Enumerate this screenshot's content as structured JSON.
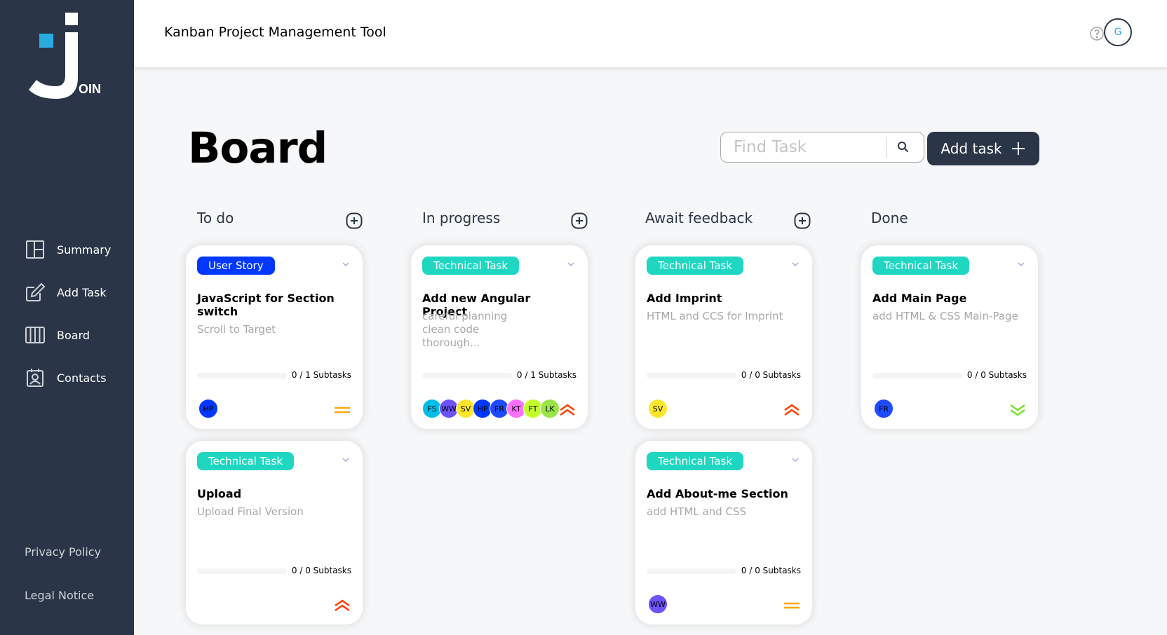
{
  "app": {
    "logo_text": "OIN",
    "header_title": "Kanban Project Management Tool",
    "user_initial": "G"
  },
  "sidebar": {
    "items": [
      {
        "label": "Summary",
        "icon": "summary-icon"
      },
      {
        "label": "Add Task",
        "icon": "edit-icon"
      },
      {
        "label": "Board",
        "icon": "board-icon"
      },
      {
        "label": "Contacts",
        "icon": "contacts-icon"
      }
    ],
    "footer": {
      "privacy": "Privacy Policy",
      "legal": "Legal Notice"
    }
  },
  "board": {
    "title": "Board",
    "search_placeholder": "Find Task",
    "add_task_label": "Add task"
  },
  "colors": {
    "sidebar": "#2a3647",
    "user_story": "#0038ff",
    "technical_task": "#1fd7c1",
    "prio_urgent": "#ff3d00",
    "prio_medium": "#ffa800",
    "prio_low": "#7ae229"
  },
  "columns": [
    {
      "title": "To do",
      "cards": [
        {
          "category": "User Story",
          "title": "JavaScript for Section switch",
          "description": "Scroll to Target",
          "subtasks": "0 / 1 Subtasks",
          "assignees": [
            {
              "initials": "HP",
              "color": "#0038ff"
            }
          ],
          "priority": "medium"
        },
        {
          "category": "Technical Task",
          "title": "Upload",
          "description": "Upload Final Version",
          "subtasks": "0 / 0 Subtasks",
          "assignees": [],
          "priority": "urgent"
        }
      ]
    },
    {
      "title": "In progress",
      "cards": [
        {
          "category": "Technical Task",
          "title": "Add new Angular Project",
          "description": "careful planning\nclean code\nthorough...",
          "subtasks": "0 / 1 Subtasks",
          "assignees": [
            {
              "initials": "FS",
              "color": "#00bee8"
            },
            {
              "initials": "WW",
              "color": "#6e52ff"
            },
            {
              "initials": "SV",
              "color": "#ffe62b"
            },
            {
              "initials": "HP",
              "color": "#0038ff"
            },
            {
              "initials": "FR",
              "color": "#1f4bff"
            },
            {
              "initials": "KT",
              "color": "#fc71ff"
            },
            {
              "initials": "FT",
              "color": "#c3ff2b"
            },
            {
              "initials": "LK",
              "color": "#9ae64a"
            }
          ],
          "priority": "urgent"
        }
      ]
    },
    {
      "title": "Await feedback",
      "cards": [
        {
          "category": "Technical Task",
          "title": "Add Imprint",
          "description": "HTML and CCS for Imprint",
          "subtasks": "0 / 0 Subtasks",
          "assignees": [
            {
              "initials": "SV",
              "color": "#ffe62b"
            }
          ],
          "priority": "urgent"
        },
        {
          "category": "Technical Task",
          "title": "Add About-me Section",
          "description": "add HTML and CSS",
          "subtasks": "0 / 0 Subtasks",
          "assignees": [
            {
              "initials": "WW",
              "color": "#6e52ff"
            }
          ],
          "priority": "medium"
        }
      ]
    },
    {
      "title": "Done",
      "cards": [
        {
          "category": "Technical Task",
          "title": "Add Main Page",
          "description": "add HTML & CSS Main-Page",
          "subtasks": "0 / 0 Subtasks",
          "assignees": [
            {
              "initials": "FR",
              "color": "#1f4bff"
            }
          ],
          "priority": "low"
        }
      ]
    }
  ]
}
